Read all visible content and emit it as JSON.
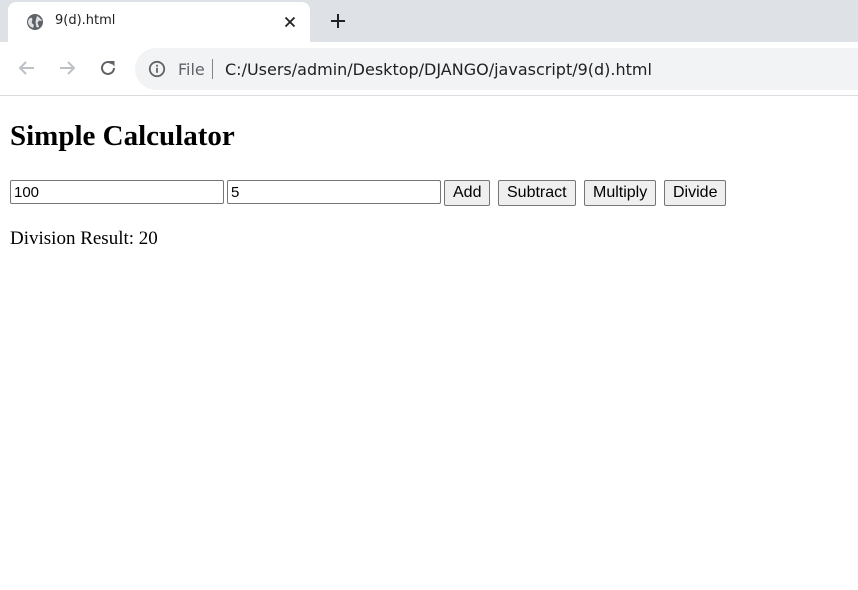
{
  "browser": {
    "tab": {
      "title": "9(d).html",
      "close_glyph": "✕"
    },
    "new_tab_glyph": "+",
    "address_bar": {
      "scheme_label": "File",
      "url": "C:/Users/admin/Desktop/DJANGO/javascript/9(d).html"
    },
    "icons": {
      "favicon": "globe-icon",
      "back": "back-arrow-icon",
      "forward": "forward-arrow-icon",
      "reload": "reload-icon",
      "info": "info-icon"
    }
  },
  "page": {
    "title": "Simple Calculator",
    "input1": {
      "value": "100"
    },
    "input2": {
      "value": "5"
    },
    "buttons": {
      "add": "Add",
      "subtract": "Subtract",
      "multiply": "Multiply",
      "divide": "Divide"
    },
    "result_text": "Division Result: 20"
  }
}
